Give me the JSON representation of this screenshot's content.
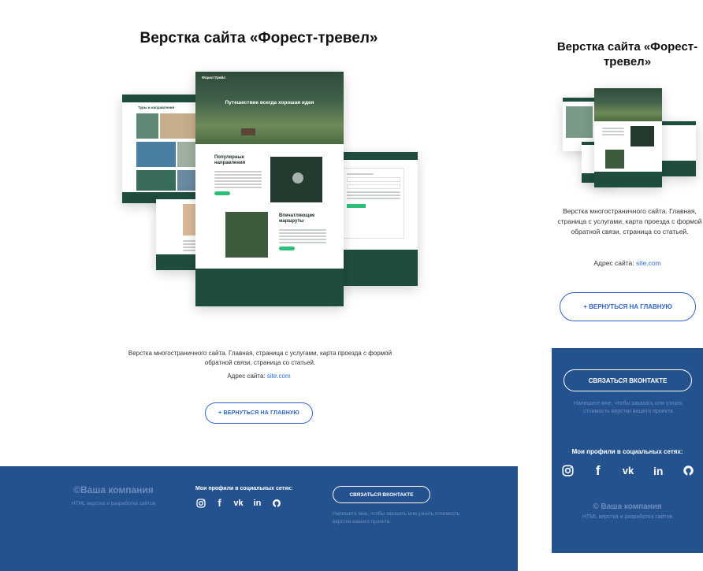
{
  "desktop": {
    "title": "Верстка сайта «Форест-тревел»",
    "description": "Верстка многостраничного сайта. Главная, страница с услугами, карта проезда с формой обратной связи, страница со статьей.",
    "address_label": "Адрес сайта: ",
    "address_link": "site.com",
    "back_button": "+ ВЕРНУТЬСЯ НА ГЛАВНУЮ",
    "footer": {
      "company": "©Ваша компания",
      "company_sub": "HTML верстка и разработка сайтов",
      "social_title": "Мои профили в социальных сетях:",
      "vk_button": "СВЯЗАТЬСЯ ВКОНТАКТЕ",
      "note": "Напишите мне, чтобы заказать или узнать стоимость верстки вашего проекта"
    },
    "mockup": {
      "hero_text": "Путешествие всегда хорошая идея",
      "popular": "Популярные направления",
      "routes": "Впечатляющие маршруты",
      "tours": "Туры и направления",
      "logo": "ФорестТрейл"
    }
  },
  "mobile": {
    "title": "Верстка сайта «Форест-тревел»",
    "description": "Верстка многостраничного сайта. Главная, страница с услугами, карта проезда с формой обратной связи, страница со статьей.",
    "address_label": "Адрес сайта: ",
    "address_link": "site.com",
    "back_button": "+ ВЕРНУТЬСЯ НА ГЛАВНУЮ",
    "footer": {
      "vk_button": "СВЯЗАТЬСЯ ВКОНТАКТЕ",
      "note": "Напишите мне, чтобы заказать или узнать стоимость верстки вашего проекта",
      "social_title": "Мои профили в социальных сетях:",
      "company": "© Ваша компания",
      "company_sub": "HTML верстка и разработка сайтов"
    }
  },
  "icons": [
    "instagram-icon",
    "facebook-icon",
    "vk-icon",
    "linkedin-icon",
    "github-icon"
  ],
  "colors": {
    "footer": "#24528f",
    "accent": "#2f63c9",
    "forest": "#1f4d3c",
    "muted": "#6d8dbf"
  }
}
